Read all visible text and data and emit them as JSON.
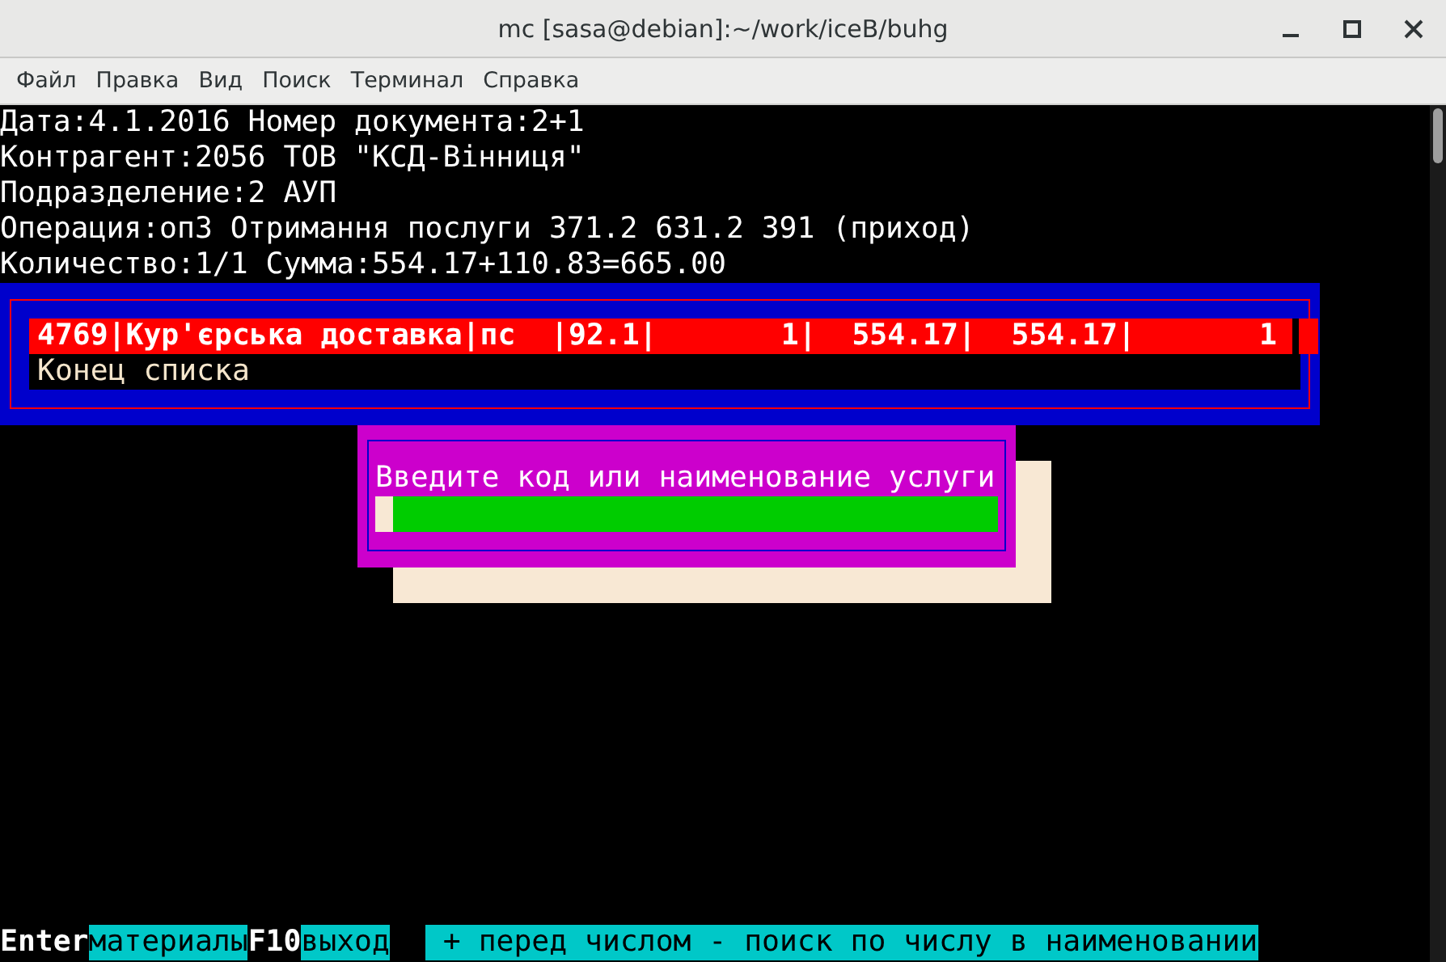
{
  "window": {
    "title": "mc [sasa@debian]:~/work/iceB/buhg"
  },
  "menu": [
    "Файл",
    "Правка",
    "Вид",
    "Поиск",
    "Терминал",
    "Справка"
  ],
  "header_lines": [
    "Дата:4.1.2016 Номер документа:2+1",
    "Контрагент:2056 ТОВ \"КСД-Вінниця\"",
    "Подразделение:2 АУП",
    "Операция:оп3 Отримання послуги 371.2 631.2 391 (приход)",
    "Количество:1/1 Сумма:554.17+110.83=665.00"
  ],
  "list": {
    "rows": [
      {
        "text": "4769|Кур'єрська доставка|пс  |92.1|       1|  554.17|  554.17|       1",
        "selected": true
      }
    ],
    "end_label": "Конец списка"
  },
  "dialog": {
    "prompt": "Введите код или наименование услуги"
  },
  "hints": [
    {
      "text": "Enter",
      "kind": "key"
    },
    {
      "text": "материалы",
      "kind": "label"
    },
    {
      "text": "F10",
      "kind": "key"
    },
    {
      "text": "выход",
      "kind": "label"
    },
    {
      "text": "+ перед числом - поиск по числу в наименовании",
      "kind": "note"
    }
  ]
}
